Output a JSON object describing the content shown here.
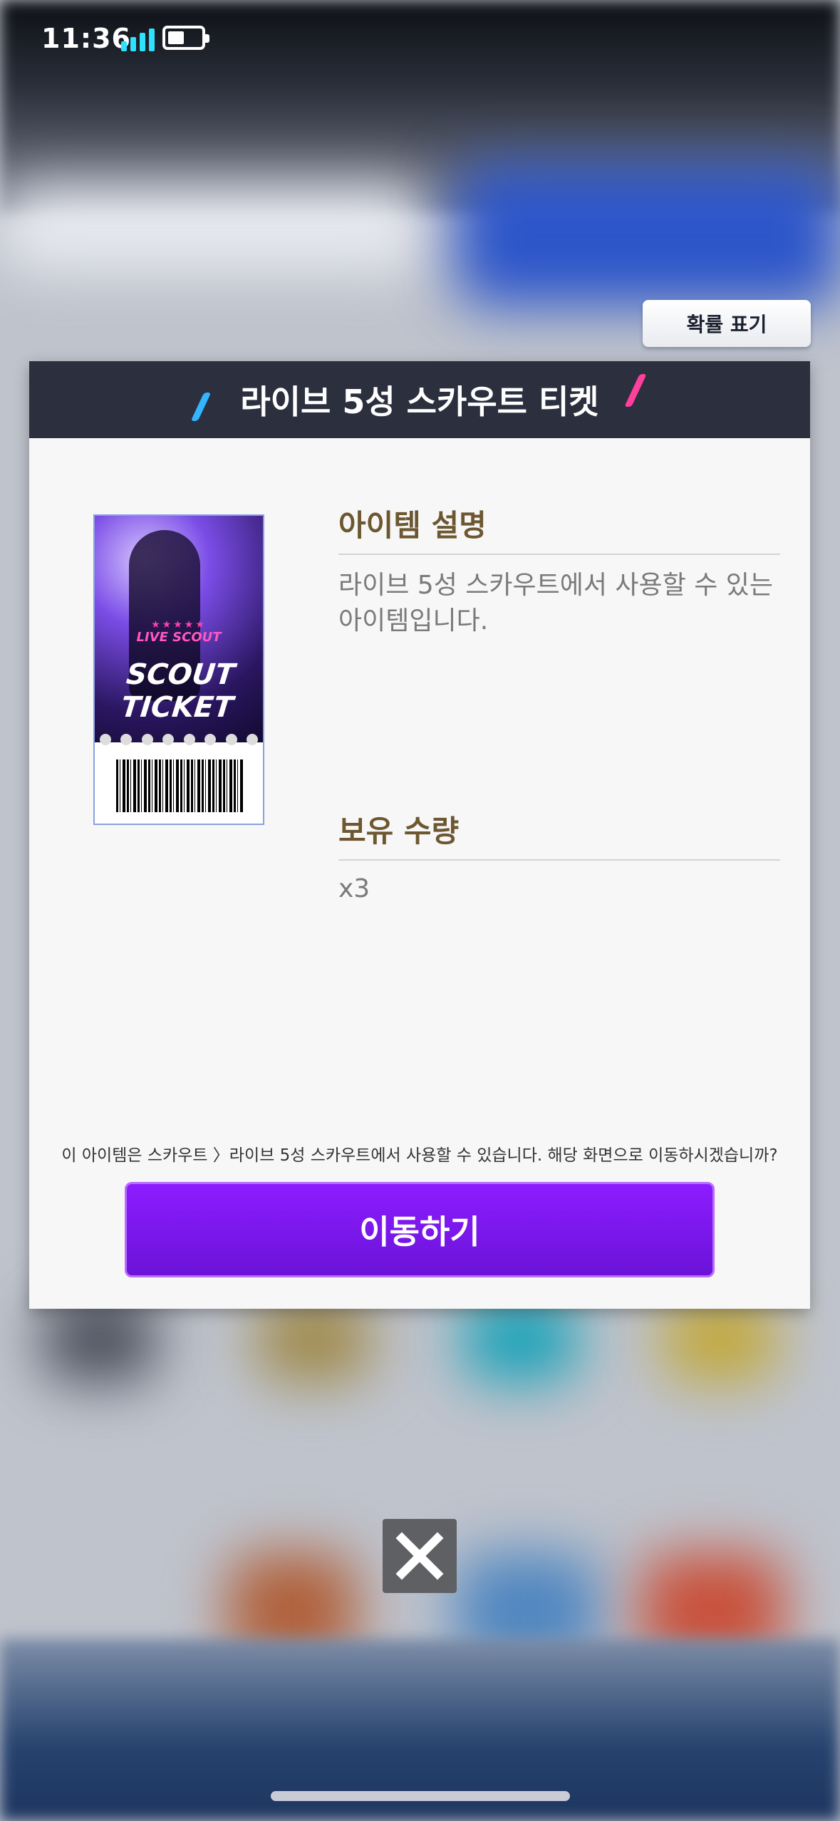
{
  "status_bar": {
    "time": "11:36"
  },
  "probability_button": {
    "label": "확률 표기"
  },
  "modal": {
    "title": "라이브 5성 스카우트 티켓",
    "ticket_image": {
      "line1": "LIVE SCOUT",
      "line2": "SCOUT",
      "line3": "TICKET"
    },
    "description_title": "아이템 설명",
    "description_text": "라이브 5성 스카우트에서 사용할 수 있는 아이템입니다.",
    "quantity_title": "보유 수량",
    "quantity_value": "x3",
    "notice": "이 아이템은 스카우트 〉라이브 5성 스카우트에서 사용할 수 있습니다. 해당 화면으로 이동하시겠습니까?",
    "move_button": "이동하기"
  },
  "colors": {
    "accent": "#7a16f0",
    "header": "#2b2f3e",
    "section_title": "#6c5730"
  }
}
